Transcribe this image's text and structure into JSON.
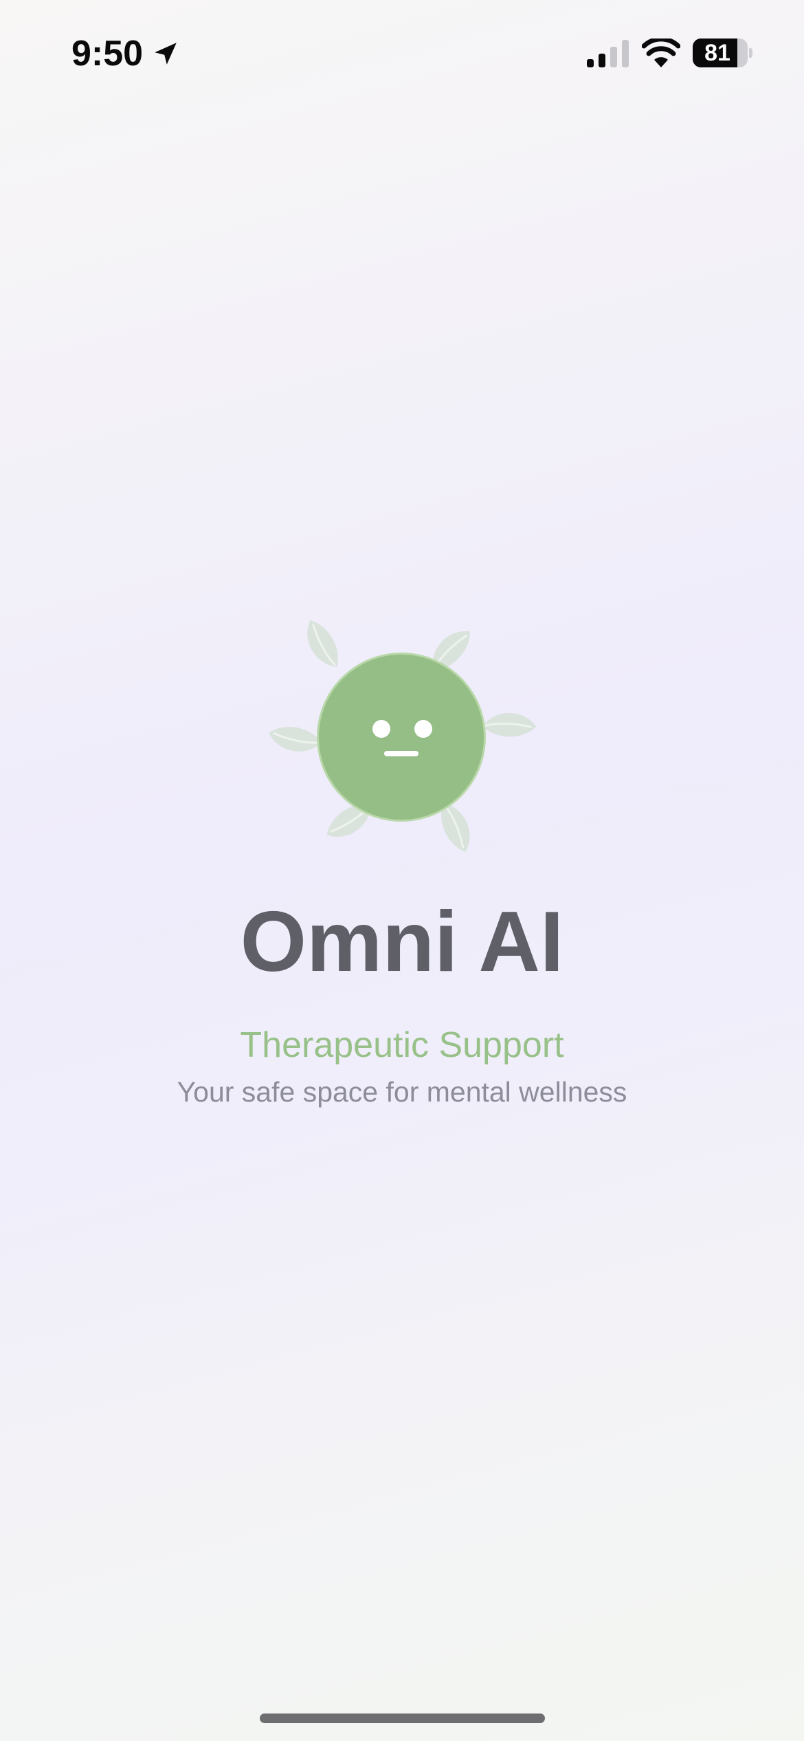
{
  "status_bar": {
    "time": "9:50",
    "battery_level": 81,
    "battery_text": "81",
    "icons": [
      "location-arrow-icon",
      "cellular-signal-icon",
      "wifi-icon",
      "battery-icon"
    ],
    "signal_bars_active": 2
  },
  "splash": {
    "title": "Omni AI",
    "tagline": "Therapeutic Support",
    "subtitle": "Your safe space for mental wellness",
    "logo": {
      "icon": "neutral-face-icon",
      "leaf_icon": "leaf-icon",
      "face_color": "#95bd86",
      "leaf_color": "#d9e3dc"
    }
  },
  "colors": {
    "title": "#5f5f67",
    "tagline": "#97c188",
    "subtitle": "#8d8c9b",
    "home_indicator": "#6e6e70"
  }
}
